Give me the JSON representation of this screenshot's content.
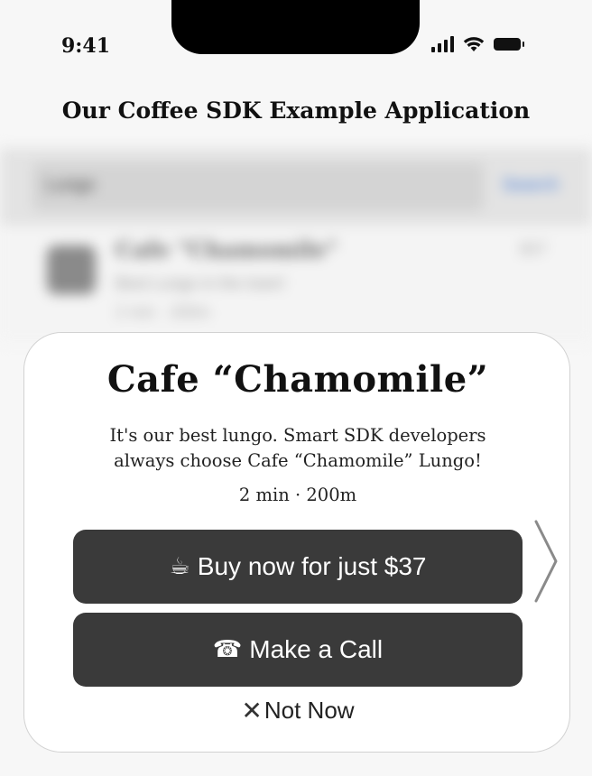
{
  "status_bar": {
    "time": "9:41",
    "signal_icon": "cellular-signal-icon",
    "wifi_icon": "wifi-icon",
    "battery_icon": "battery-icon"
  },
  "header": {
    "title": "Our Coffee SDK Example Application"
  },
  "background": {
    "search_text": "Lungo",
    "search_button": "Search",
    "row_title": "Cafe \"Chamomile\"",
    "row_subtitle": "Best Lungo in the town!",
    "row_meta": "2 min · 200m",
    "row_price": "$37"
  },
  "card": {
    "title": "Cafe “Chamomile”",
    "description": "It's our best lungo. Smart SDK developers always choose Cafe “Chamomile” Lungo!",
    "meta": "2 min · 200m",
    "buy_icon": "☕",
    "buy_label": "Buy now for just $37",
    "call_icon": "☎",
    "call_label": "Make a Call",
    "dismiss_icon": "✕",
    "dismiss_label": "Not Now",
    "next_icon": "chevron-right-icon"
  },
  "colors": {
    "button_bg": "#3a3a3a",
    "card_bg": "#ffffff",
    "search_accent": "#4a7fd8"
  }
}
